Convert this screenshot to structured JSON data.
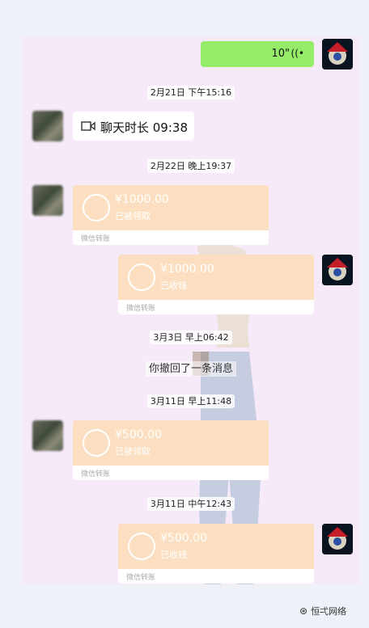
{
  "messages": {
    "voice": {
      "duration": "10\"",
      "icon": "voice-wave-icon"
    },
    "ts1": "2月21日 下午15:16",
    "video_call": {
      "icon": "video-icon",
      "text": "聊天时长 09:38"
    },
    "ts2": "2月22日 晚上19:37",
    "transfer1": {
      "amount": "¥1000.00",
      "status": "已被领取",
      "label": "微信转账"
    },
    "transfer2": {
      "amount": "¥1000.00",
      "status": "已收钱",
      "label": "微信转账"
    },
    "ts3": "3月3日 早上06:42",
    "recalled": "你撤回了一条消息",
    "ts4": "3月11日 早上11:48",
    "transfer3": {
      "amount": "¥500.00",
      "status": "已被领取",
      "label": "微信转账"
    },
    "ts5": "3月11日 中午12:43",
    "transfer4": {
      "amount": "¥500.00",
      "status": "已收钱",
      "label": "微信转账"
    }
  },
  "watermark": {
    "icon": "wechat-channel-icon",
    "text": "恒弌网络"
  },
  "colors": {
    "voice_bubble": "#95ec69",
    "transfer_bubble": "#fbdfc0",
    "chat_bg": "#f6e9f8"
  }
}
